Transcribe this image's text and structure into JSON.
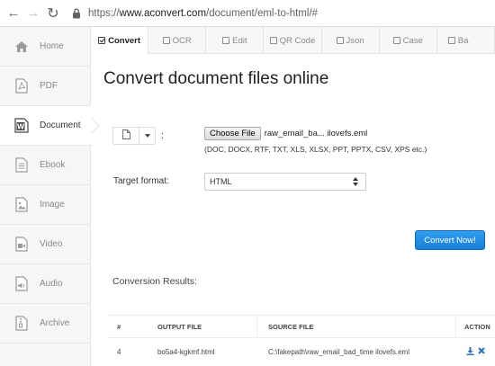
{
  "browser": {
    "url_prefix": "https://",
    "url_host": "www.aconvert.com",
    "url_path": "/document/eml-to-html/#"
  },
  "sidebar": {
    "items": [
      {
        "label": "Home",
        "icon": "home-icon"
      },
      {
        "label": "PDF",
        "icon": "pdf-icon"
      },
      {
        "label": "Document",
        "icon": "word-document-icon",
        "active": true
      },
      {
        "label": "Ebook",
        "icon": "ebook-icon"
      },
      {
        "label": "Image",
        "icon": "image-icon"
      },
      {
        "label": "Video",
        "icon": "video-icon"
      },
      {
        "label": "Audio",
        "icon": "audio-icon"
      },
      {
        "label": "Archive",
        "icon": "archive-icon"
      }
    ]
  },
  "tabs": [
    {
      "label": "Convert",
      "active": true
    },
    {
      "label": "OCR"
    },
    {
      "label": "Edit"
    },
    {
      "label": "QR Code"
    },
    {
      "label": "Json"
    },
    {
      "label": "Case"
    },
    {
      "label": "Ba"
    }
  ],
  "main": {
    "title": "Convert document files online",
    "upload": {
      "colon": ":",
      "choose_label": "Choose File",
      "file_name": "raw_email_ba... ilovefs.eml",
      "formats": "(DOC, DOCX, RTF, TXT, XLS, XLSX, PPT, PPTX, CSV, XPS etc.)"
    },
    "target": {
      "label": "Target format:",
      "value": "HTML"
    },
    "convert_button": "Convert Now!",
    "results_label": "Conversion Results:",
    "table": {
      "headers": [
        "#",
        "OUTPUT FILE",
        "SOURCE FILE",
        "ACTION"
      ],
      "rows": [
        {
          "num": "4",
          "output": "bo5a4-kgkmf.html",
          "source": "C:\\fakepath\\raw_email_bad_time ilovefs.eml"
        }
      ]
    }
  },
  "colors": {
    "accent": "#1a7fd6",
    "link": "#1a6fbf",
    "sidebar_bg": "#f6f6f6"
  }
}
